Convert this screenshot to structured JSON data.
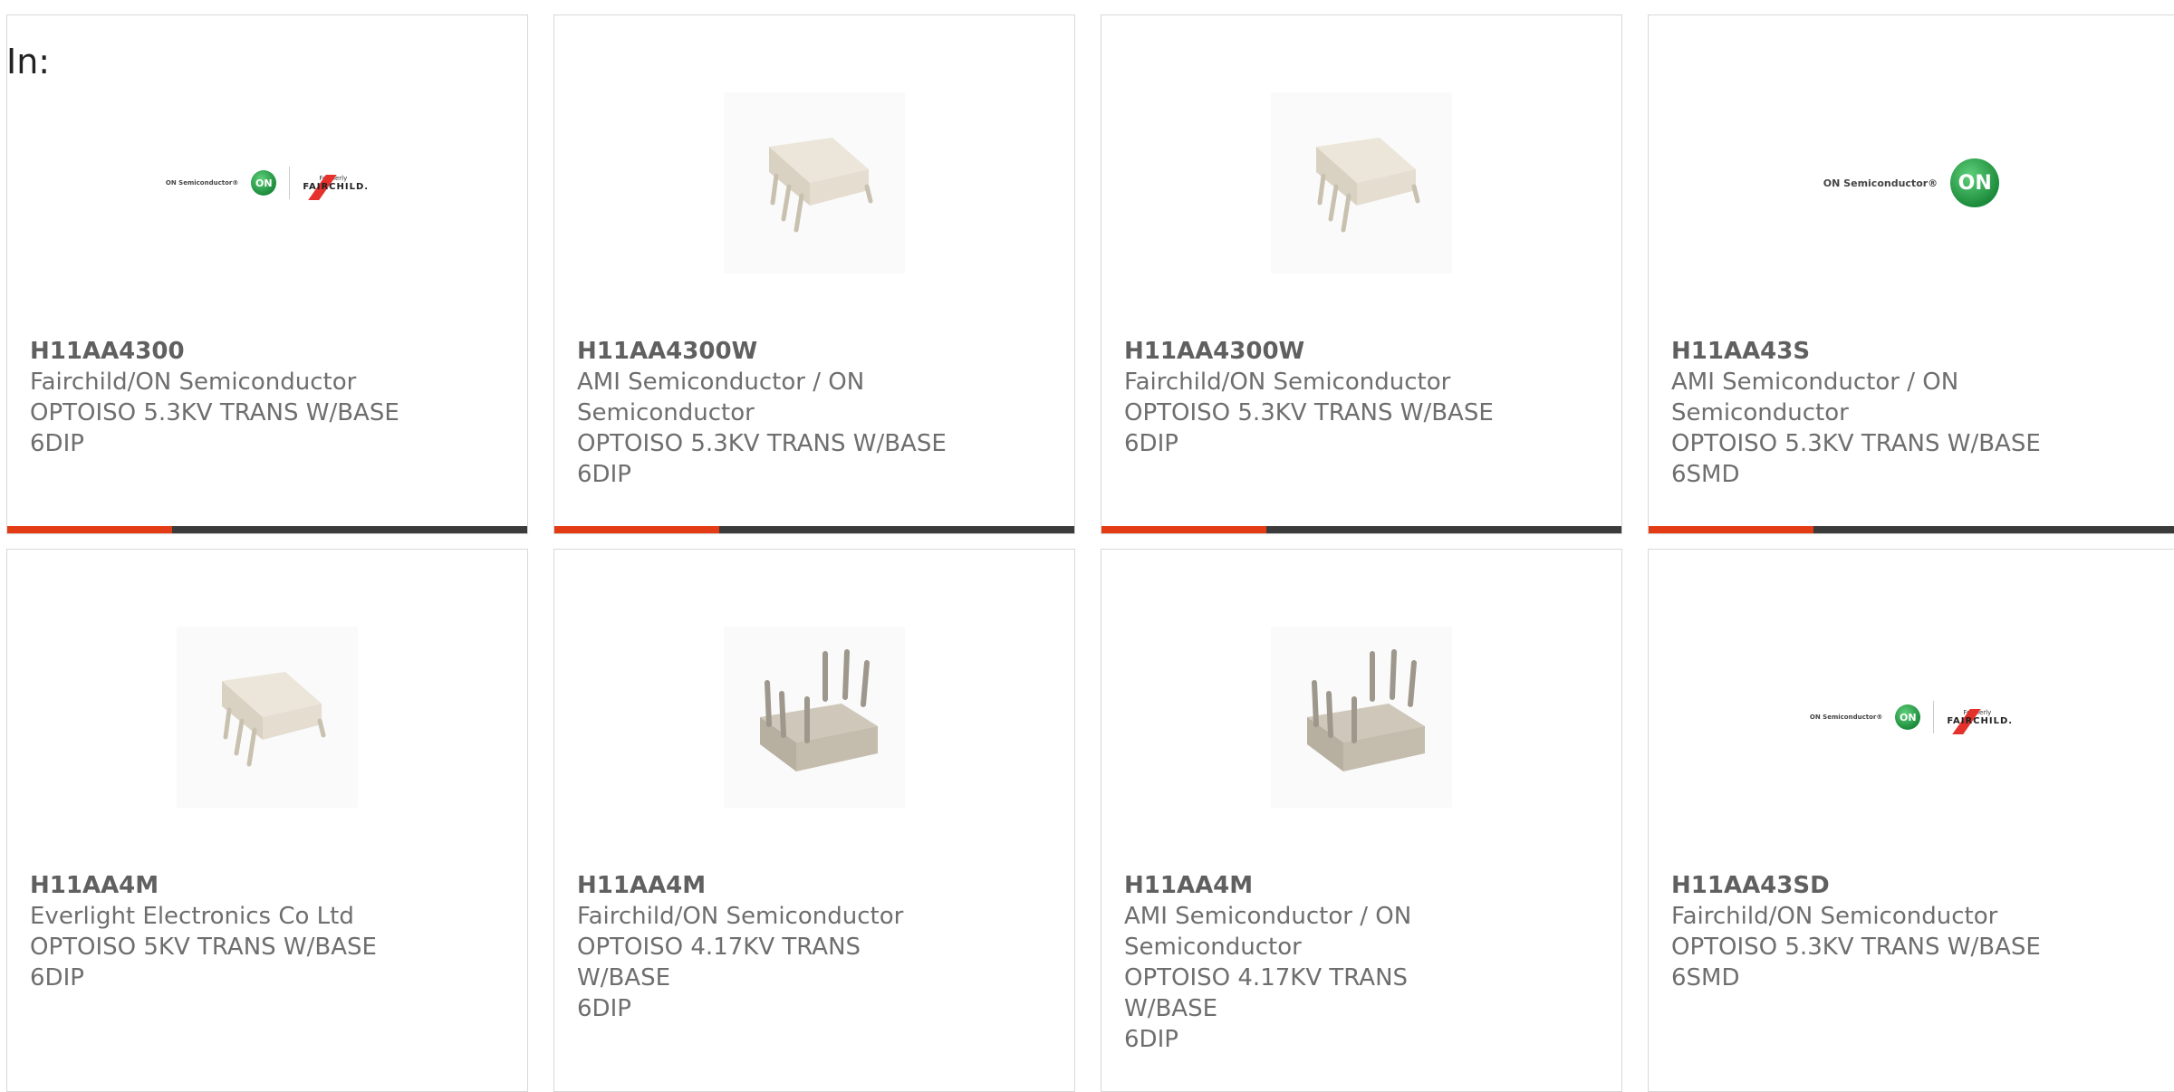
{
  "filter_label": "In:",
  "colors": {
    "accent": "#e33b14",
    "bar": "#3b3b3b",
    "text": "#6e6e6e"
  },
  "products": [
    {
      "part": "H11AA4300",
      "manufacturer": "Fairchild/ON Semiconductor",
      "description": "OPTOISO 5.3KV TRANS W/BASE",
      "package": "6DIP",
      "image": "on-fairchild-logo"
    },
    {
      "part": "H11AA4300W",
      "manufacturer": "AMI Semiconductor / ON Semiconductor",
      "description": "OPTOISO 5.3KV TRANS W/BASE",
      "package": "6DIP",
      "image": "6dip-chip-photo"
    },
    {
      "part": "H11AA4300W",
      "manufacturer": "Fairchild/ON Semiconductor",
      "description": "OPTOISO 5.3KV TRANS W/BASE",
      "package": "6DIP",
      "image": "6dip-chip-photo"
    },
    {
      "part": "H11AA43S",
      "manufacturer": "AMI Semiconductor / ON Semiconductor",
      "description": "OPTOISO 5.3KV TRANS W/BASE",
      "package": "6SMD",
      "image": "on-semiconductor-logo"
    },
    {
      "part": "H11AA4M",
      "manufacturer": "Everlight Electronics Co Ltd",
      "description": "OPTOISO 5KV TRANS W/BASE",
      "package": "6DIP",
      "image": "6dip-chip-photo"
    },
    {
      "part": "H11AA4M",
      "manufacturer": "Fairchild/ON Semiconductor",
      "description": "OPTOISO 4.17KV TRANS W/BASE",
      "package": "6DIP",
      "image": "6dip-pins-up-photo"
    },
    {
      "part": "H11AA4M",
      "manufacturer": "AMI Semiconductor / ON Semiconductor",
      "description": "OPTOISO 4.17KV TRANS W/BASE",
      "package": "6DIP",
      "image": "6dip-pins-up-photo"
    },
    {
      "part": "H11AA43SD",
      "manufacturer": "Fairchild/ON Semiconductor",
      "description": "OPTOISO 5.3KV TRANS W/BASE",
      "package": "6SMD",
      "image": "on-fairchild-logo"
    }
  ],
  "logo_text": {
    "on_semiconductor": "ON Semiconductor®",
    "on": "ON",
    "formerly": "Formerly",
    "fairchild": "FAIRCHILD."
  }
}
